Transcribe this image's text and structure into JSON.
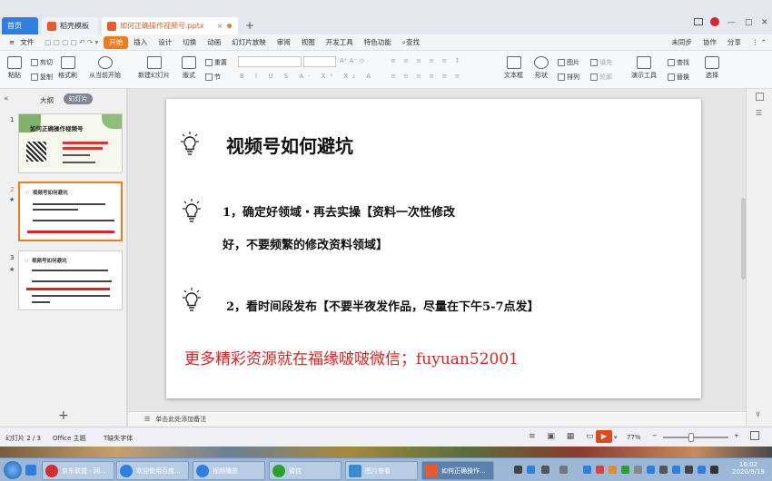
{
  "titlebar": {
    "tabs": [
      {
        "label": "首页",
        "color": "#2f7fe0"
      },
      {
        "label": "稻壳模板",
        "color": "#e85a2a"
      },
      {
        "label": "如何正确操作视频号.pptx",
        "color": "#e85a2a"
      }
    ],
    "add_tab": "+"
  },
  "menubar": {
    "file": "文件",
    "items": [
      "开始",
      "插入",
      "设计",
      "切换",
      "动画",
      "幻灯片放映",
      "审阅",
      "视图",
      "开发工具",
      "特色功能"
    ],
    "search": "查找",
    "sync": "未同步",
    "collab": "协作",
    "share": "分享"
  },
  "ribbon": {
    "paste": "粘贴",
    "cut": "剪切",
    "copy": "复制",
    "format_painter": "格式刷",
    "play_from_current": "从当前开始",
    "new_slide": "新建幻灯片",
    "layout": "版式",
    "section": "节",
    "reset": "重置",
    "textbox": "文本框",
    "shape": "形状",
    "arrange": "排列",
    "picture": "图片",
    "fill": "填充",
    "outline": "轮廓",
    "presentation_tools": "演示工具",
    "find": "查找",
    "replace": "替换",
    "select": "选择"
  },
  "leftpanel": {
    "outline_tab": "大纲",
    "slides_tab": "幻灯片",
    "thumbs": [
      {
        "num": "1",
        "title": "如何正确操作视频号"
      },
      {
        "num": "2",
        "title": "视频号如何避坑"
      },
      {
        "num": "3",
        "title": "视频号如何避坑"
      }
    ],
    "add": "+"
  },
  "slide": {
    "title": "视频号如何避坑",
    "point1_line1": "1，确定好领域・再去实操【资料一次性修改",
    "point1_line2": "好，不要频繁的修改资料领域】",
    "point2": "2，看时间段发布【不要半夜发作品，尽量在下午5-7点发】",
    "promo": "更多精彩资源就在福缘啵啵微信；fuyuan52001",
    "promo_color": "#e02020"
  },
  "notes": {
    "placeholder": "单击此处添加备注"
  },
  "statusbar": {
    "slide_count": "幻灯片 2 / 3",
    "theme": "Office 主题",
    "missing_font": "缺失字体",
    "zoom": "77%"
  },
  "taskbar": {
    "tasks": [
      {
        "label": "京东联盟 - 网...",
        "color": "#d03030"
      },
      {
        "label": "欢迎使用百度...",
        "color": "#2f7fe0"
      },
      {
        "label": "视频播放",
        "color": "#2f7fe0"
      },
      {
        "label": "微信",
        "color": "#2ca02c"
      },
      {
        "label": "图片查看",
        "color": "#3a8ad0"
      },
      {
        "label": "如何正确操作...",
        "color": "#e85a2a"
      }
    ],
    "time": "16:02",
    "date": "2020/9/19"
  }
}
